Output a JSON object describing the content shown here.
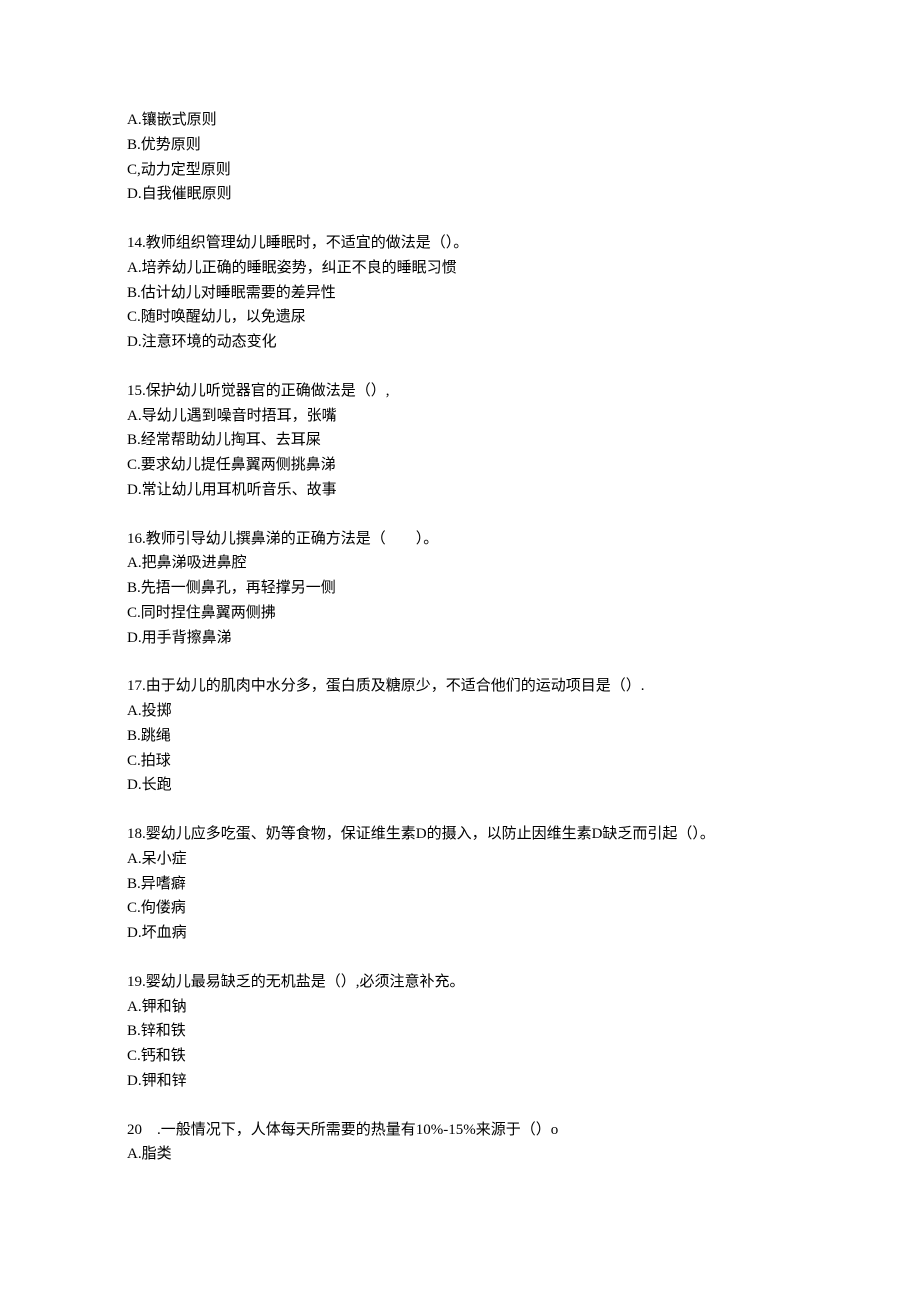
{
  "questions": [
    {
      "stem": "",
      "options": [
        "A.镶嵌式原则",
        "B.优势原则",
        "C,动力定型原则",
        "D.自我催眠原则"
      ]
    },
    {
      "stem": "14.教师组织管理幼儿睡眠时，不适宜的做法是（）。",
      "options": [
        "A.培养幼儿正确的睡眠姿势，纠正不良的睡眠习惯",
        "B.估计幼儿对睡眠需要的差异性",
        "C.随时唤醒幼儿，以免遗尿",
        "D.注意环境的动态变化"
      ]
    },
    {
      "stem": "15.保护幼儿听觉器官的正确做法是（）,",
      "options": [
        "A.导幼儿遇到噪音时捂耳，张嘴",
        "B.经常帮助幼儿掏耳、去耳屎",
        "C.要求幼儿提任鼻翼两侧挑鼻涕",
        "D.常让幼儿用耳机听音乐、故事"
      ]
    },
    {
      "stem": "16.教师引导幼儿撰鼻涕的正确方法是（　　）。",
      "options": [
        "A.把鼻涕吸进鼻腔",
        "B.先捂一侧鼻孔，再轻撑另一侧",
        "C.同时捏住鼻翼两侧拂",
        "D.用手背擦鼻涕"
      ]
    },
    {
      "stem": "17.由于幼儿的肌肉中水分多，蛋白质及糖原少，不适合他们的运动项目是（）.",
      "options": [
        "A.投掷",
        "B.跳绳",
        "C.拍球",
        "D.长跑"
      ]
    },
    {
      "stem": "18.婴幼儿应多吃蛋、奶等食物，保证维生素D的摄入，以防止因维生素D缺乏而引起（）。",
      "options": [
        "A.呆小症",
        "B.异嗜癖",
        "C.佝偻病",
        "D.坏血病"
      ]
    },
    {
      "stem": "19.婴幼儿最易缺乏的无机盐是（）,必须注意补充。",
      "options": [
        "A.钾和钠",
        "B.锌和铁",
        "C.钙和铁",
        "D.钾和锌"
      ]
    },
    {
      "stem": "20　.一般情况下，人体每天所需要的热量有10%-15%来源于（）o",
      "options": [
        "A.脂类"
      ]
    }
  ]
}
